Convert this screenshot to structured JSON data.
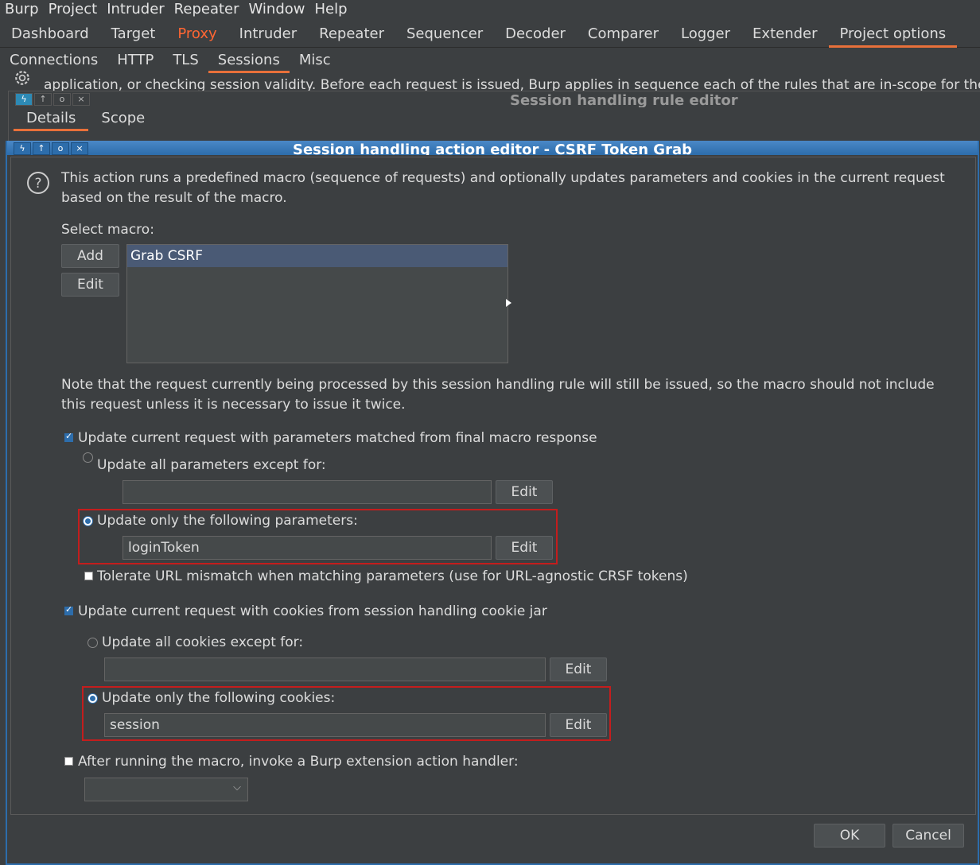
{
  "menubar": [
    "Burp",
    "Project",
    "Intruder",
    "Repeater",
    "Window",
    "Help"
  ],
  "main_tabs": [
    "Dashboard",
    "Target",
    "Proxy",
    "Intruder",
    "Repeater",
    "Sequencer",
    "Decoder",
    "Comparer",
    "Logger",
    "Extender",
    "Project options"
  ],
  "sub_tabs": [
    "Connections",
    "HTTP",
    "TLS",
    "Sessions",
    "Misc"
  ],
  "background_text": "application, or checking session validity. Before each request is issued, Burp applies in sequence each of the rules that are in-scope for the",
  "rule_editor": {
    "title": "Session handling rule editor",
    "tabs": [
      "Details",
      "Scope"
    ]
  },
  "action_editor": {
    "title": "Session handling action editor - CSRF Token Grab",
    "description_line1": "This action runs a predefined macro (sequence of requests) and optionally updates parameters and cookies in the current request",
    "description_line2": "based on the result of the macro.",
    "select_macro_label": "Select macro:",
    "add_label": "Add",
    "edit_label": "Edit",
    "macros": [
      "Grab CSRF"
    ],
    "note_line1": "Note that the request currently being processed by this session handling rule will still be issued, so the macro should not include",
    "note_line2": "this request unless it is necessary to issue it twice.",
    "update_params_label": "Update current request with parameters matched from final macro response",
    "update_all_params_label": "Update all parameters except for:",
    "update_all_params_value": "",
    "update_only_params_label": "Update only the following parameters:",
    "update_only_params_value": "loginToken",
    "tolerate_label": "Tolerate URL mismatch when matching parameters (use for URL-agnostic CRSF tokens)",
    "update_cookies_label": "Update current request with cookies from session handling cookie jar",
    "update_all_cookies_label": "Update all cookies except for:",
    "update_all_cookies_value": "",
    "update_only_cookies_label": "Update only the following cookies:",
    "update_only_cookies_value": "session",
    "extension_label": "After running the macro, invoke a Burp extension action handler:",
    "ok_label": "OK",
    "cancel_label": "Cancel",
    "checkbox_state": {
      "update_params": true,
      "tolerate": false,
      "update_cookies": true,
      "extension": false
    },
    "radio_state": {
      "params": "only",
      "cookies": "only"
    }
  },
  "colors": {
    "accent_tab": "#e8703a",
    "proxy_tab": "#ff6633",
    "highlight_box": "#c41d1d",
    "title_bar": "#2d6dab"
  }
}
